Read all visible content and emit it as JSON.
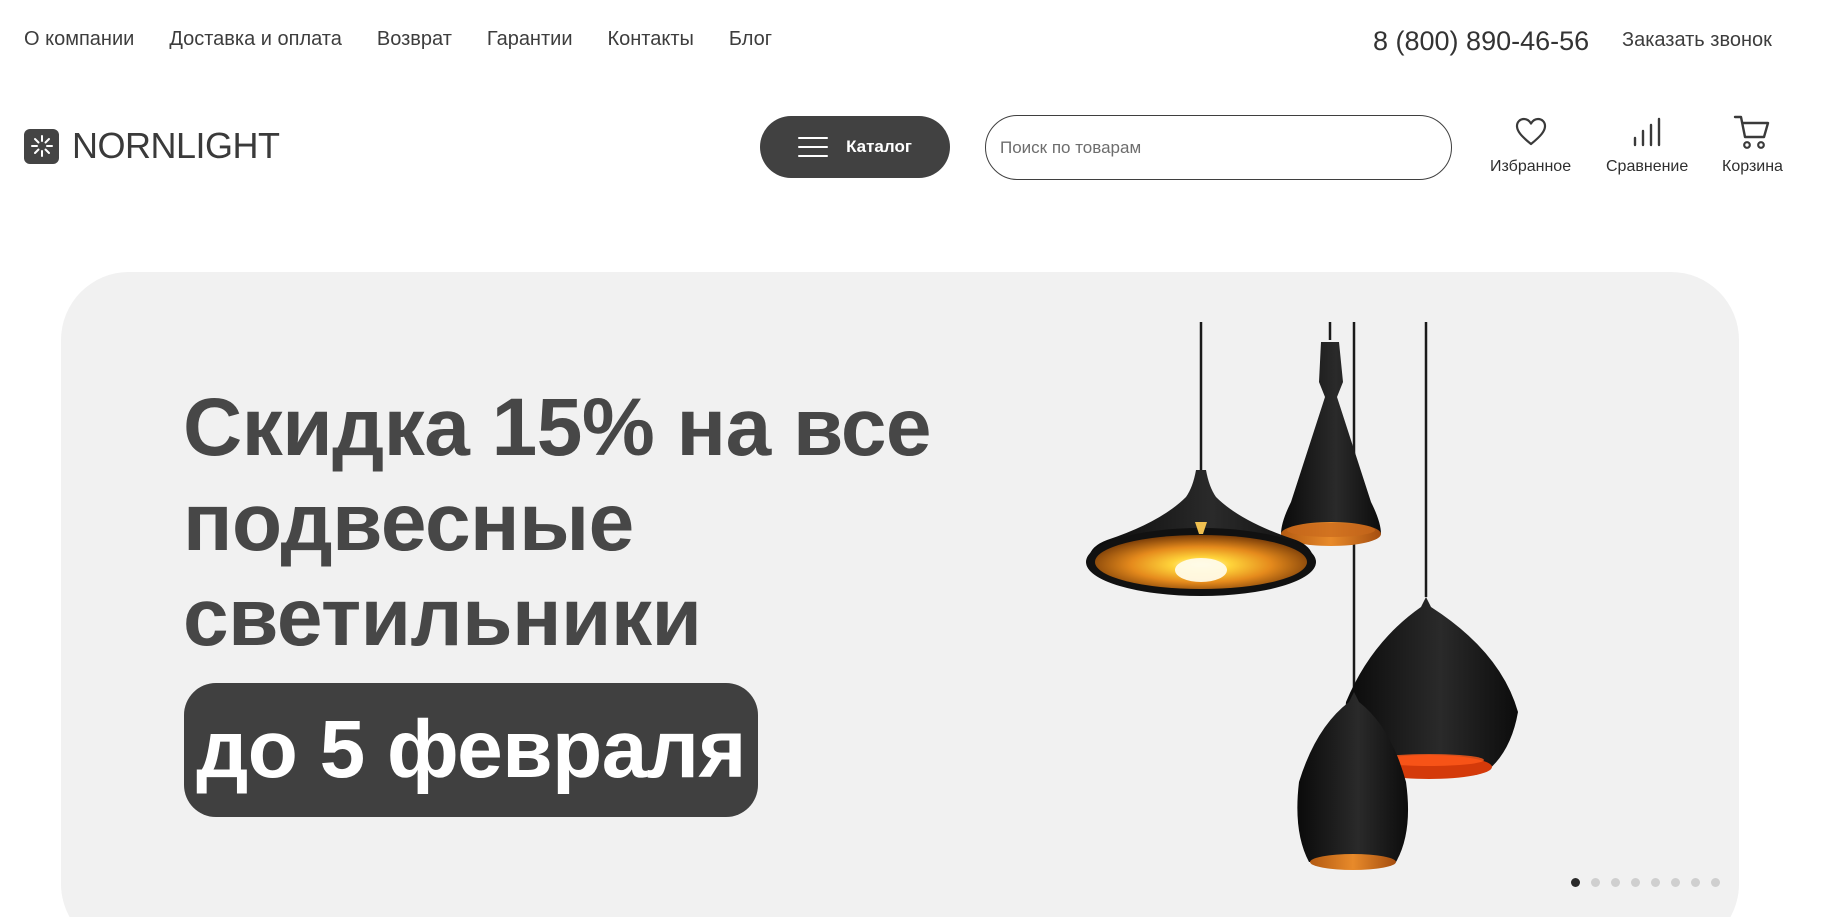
{
  "topnav": {
    "items": [
      {
        "label": "О компании"
      },
      {
        "label": "Доставка и оплата"
      },
      {
        "label": "Возврат"
      },
      {
        "label": "Гарантии"
      },
      {
        "label": "Контакты"
      },
      {
        "label": "Блог"
      }
    ],
    "phone": "8 (800) 890-46-56",
    "callback": "Заказать звонок"
  },
  "header": {
    "logo_text": "NORNLIGHT",
    "catalog_label": "Каталог",
    "search_placeholder": "Поиск по товарам",
    "favorites_label": "Избранное",
    "compare_label": "Сравнение",
    "cart_label": "Корзина",
    "icons": [
      "heart-icon",
      "compare-bars-icon",
      "cart-icon"
    ]
  },
  "banner": {
    "headline_lines": [
      "Скидка 15% на все",
      "подвесные",
      "светильники"
    ],
    "pill_text": "до 5 февраля",
    "slides_count": 8,
    "active_slide": 1,
    "colors": {
      "background": "#f1f1f1",
      "pill": "#404040",
      "text": "#474747"
    }
  }
}
